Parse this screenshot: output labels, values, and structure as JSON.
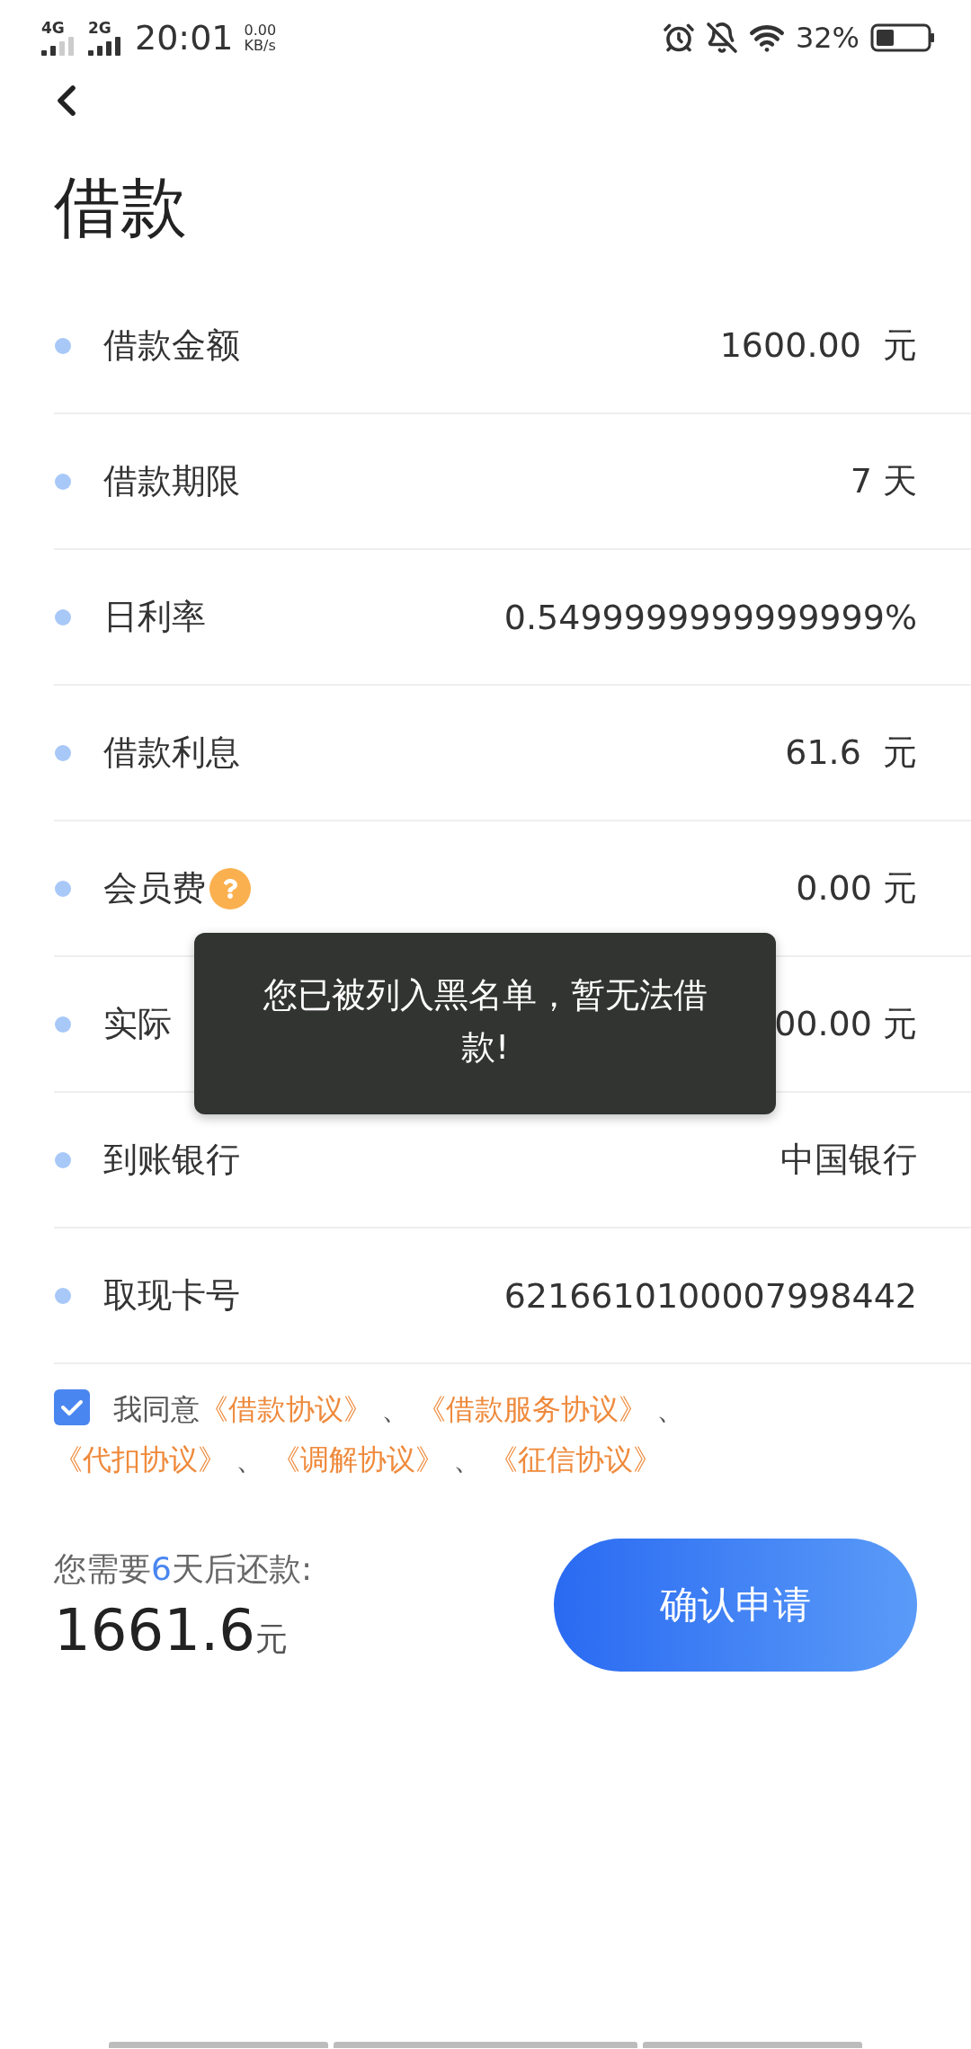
{
  "status_bar": {
    "network_1": "4G",
    "network_2": "2G",
    "time": "20:01",
    "speed": "0.00",
    "speed_unit": "KB/s",
    "battery": "32%"
  },
  "title": "借款",
  "rows": [
    {
      "label": "借款金额",
      "value": "1600.00  元",
      "help": false
    },
    {
      "label": "借款期限",
      "value": "7 天",
      "help": false
    },
    {
      "label": "日利率",
      "value": "0.5499999999999999%",
      "help": false
    },
    {
      "label": "借款利息",
      "value": "61.6  元",
      "help": false
    },
    {
      "label": "会员费",
      "value": "0.00 元",
      "help": true
    },
    {
      "label": "实际",
      "value": "00.00 元",
      "help": false
    },
    {
      "label": "到账银行",
      "value": "中国银行",
      "help": false
    },
    {
      "label": "取现卡号",
      "value": "6216610100007998442",
      "help": false
    }
  ],
  "agreement": {
    "checked": true,
    "prefix": "我同意",
    "parts": [
      {
        "kind": "link",
        "text": "《借款协议》"
      },
      {
        "kind": "sep",
        "text": " 、"
      },
      {
        "kind": "link",
        "text": "《借款服务协议》"
      },
      {
        "kind": "sep",
        "text": " 、"
      },
      {
        "kind": "link",
        "text": "《代扣协议》"
      },
      {
        "kind": "sep",
        "text": " 、"
      },
      {
        "kind": "link",
        "text": "《调解协议》"
      },
      {
        "kind": "sep",
        "text": " 、"
      },
      {
        "kind": "link",
        "text": "《征信协议》"
      }
    ]
  },
  "repay": {
    "prefix": "您需要",
    "days": "6",
    "suffix": "天后还款:",
    "amount": "1661.6",
    "unit": "元"
  },
  "confirm_button": "确认申请",
  "toast": "您已被列入黑名单，暂无法借款!"
}
